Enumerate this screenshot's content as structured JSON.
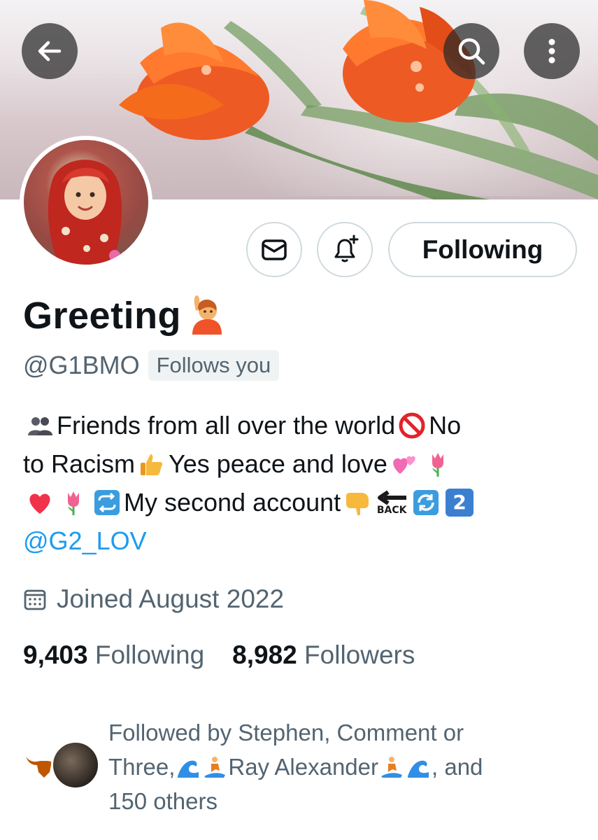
{
  "header": {
    "back_icon": "arrow-left-icon",
    "search_icon": "search-icon",
    "more_icon": "more-vertical-icon"
  },
  "profile": {
    "display_name": "Greeting",
    "name_emoji": "person-raising-hand-emoji",
    "handle": "@G1BMO",
    "follows_you_label": "Follows you"
  },
  "actions": {
    "message_icon": "envelope-icon",
    "notify_icon": "bell-plus-icon",
    "follow_label": "Following"
  },
  "bio": {
    "line1": {
      "text_a": "Friends from all over the world",
      "text_b": "No"
    },
    "line2": {
      "text_a": "to Racism",
      "text_b": "Yes peace  and love"
    },
    "line3": {
      "text_a": "My second account",
      "back_label": "BACK",
      "number": "2"
    },
    "link": "@G2_LOV"
  },
  "joined": {
    "icon": "calendar-icon",
    "text": "Joined August 2022"
  },
  "stats": {
    "following_count": "9,403",
    "following_label": "Following",
    "followers_count": "8,982",
    "followers_label": "Followers"
  },
  "followed_by": {
    "line1": "Followed by Stephen, Comment or",
    "line2_a": "Three,",
    "line2_b": "Ray Alexander",
    "line2_c": ", and",
    "line3": "150 others"
  },
  "colors": {
    "text_primary": "#0f1419",
    "text_secondary": "#536471",
    "link": "#1d9bf0",
    "border": "#cfd9de"
  }
}
